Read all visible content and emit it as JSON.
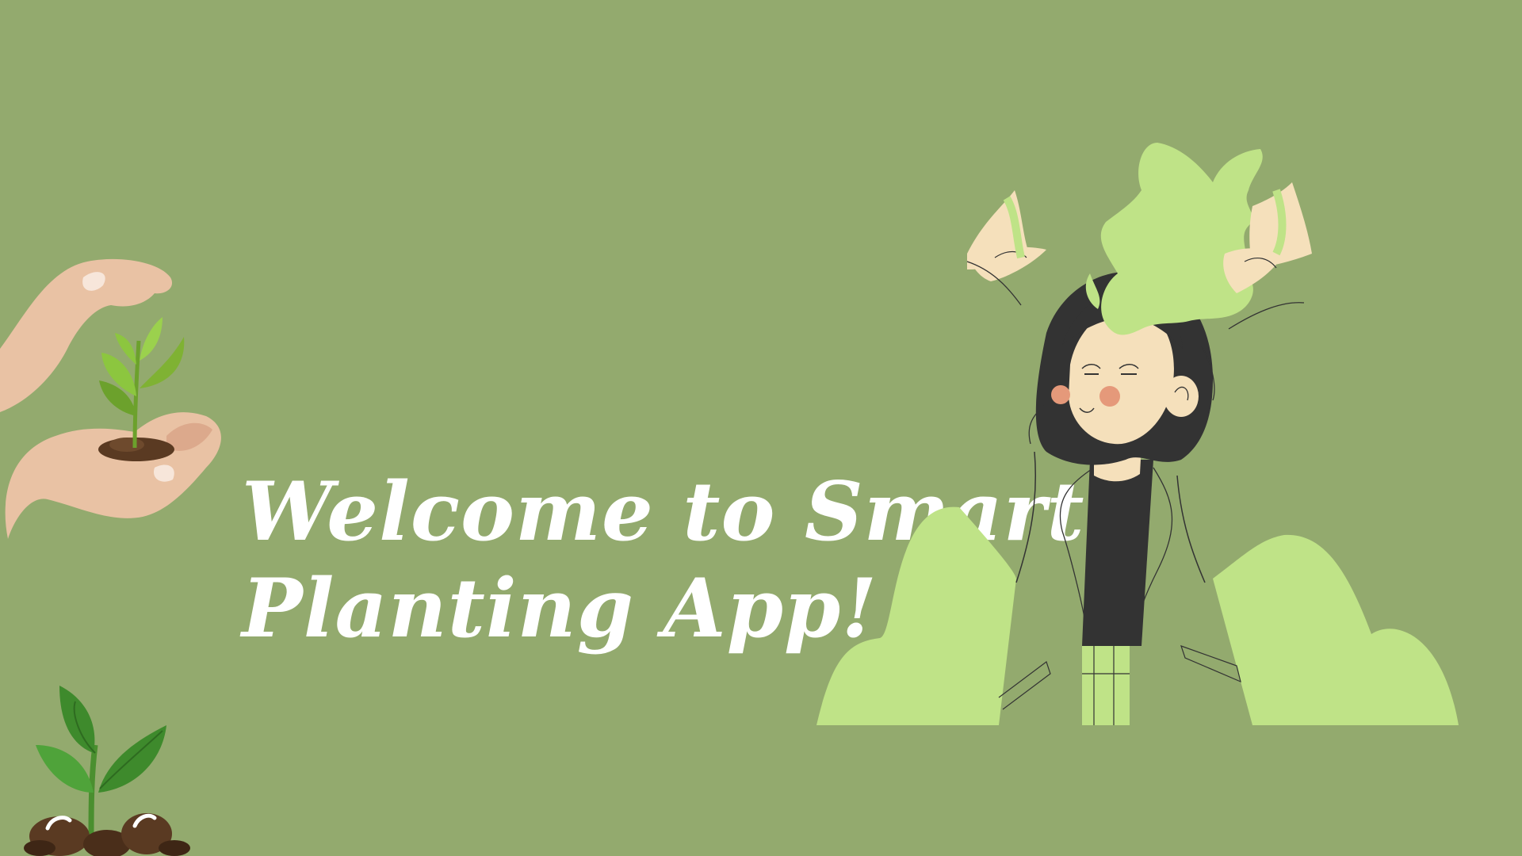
{
  "slide": {
    "background_color": "#93aa6e",
    "title_line_1": "Welcome to Smart",
    "title_line_2": "Planting App!",
    "title_color": "#ffffff"
  },
  "illustrations": {
    "hands": "hands-holding-seedling-illustration",
    "sprout": "sprout-in-soil-illustration",
    "girl": "girl-with-plant-growing-from-head-illustration"
  },
  "palette": {
    "light_green": "#bfe387",
    "skin": "#f5e0bb",
    "hair": "#333333",
    "soil": "#5a3a22",
    "leaf": "#7fb233"
  }
}
